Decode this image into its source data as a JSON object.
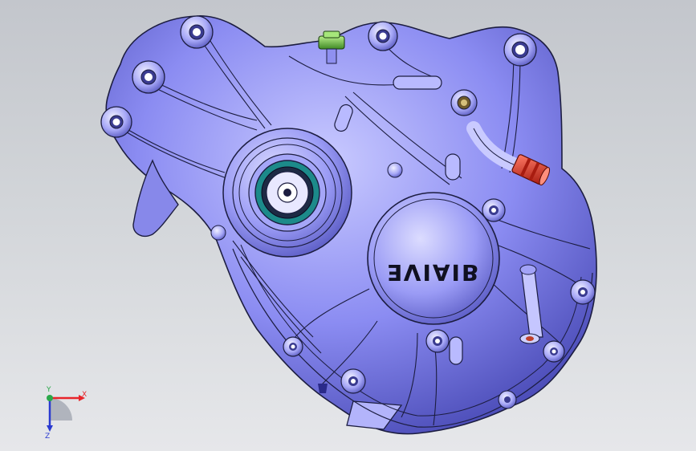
{
  "viewport": {
    "background_top": "#c3c6cc",
    "background_bottom": "#e6e7ea"
  },
  "model": {
    "body_color": "#8b8cf2",
    "edge_color": "#1c1d40",
    "highlight_color": "#d7d8ff",
    "cover_logo": "ƎVIAIB",
    "sensor_color": "#6cc24a",
    "red_fitting_color": "#e03a2a",
    "seal_color": "#1c8a8a"
  },
  "triad": {
    "x_label": "X",
    "y_label": "Y",
    "z_label": "Z",
    "x_color": "#e8242a",
    "y_color": "#2aa84a",
    "z_color": "#2a3ad0"
  }
}
